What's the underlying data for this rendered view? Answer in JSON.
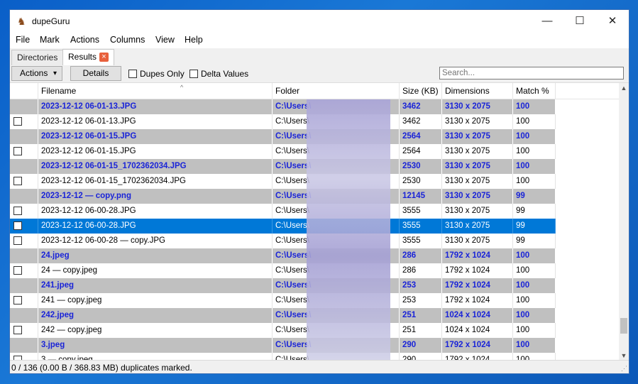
{
  "window": {
    "title": "dupeGuru",
    "minimize": "—",
    "maximize": "☐",
    "close": "✕"
  },
  "menu": [
    "File",
    "Mark",
    "Actions",
    "Columns",
    "View",
    "Help"
  ],
  "tabs": {
    "directories": "Directories",
    "results": "Results",
    "close_icon": "×"
  },
  "toolbar": {
    "actions_label": "Actions",
    "details_label": "Details",
    "dupes_only_label": "Dupes Only",
    "delta_values_label": "Delta Values",
    "search_placeholder": "Search...",
    "dropdown_icon": "▾"
  },
  "columns": [
    "Filename",
    "Folder",
    "Size (KB)",
    "Dimensions",
    "Match %"
  ],
  "sort_indicator": "^",
  "rows": [
    {
      "ref": true,
      "filename": "2023-12-12 06-01-13.JPG",
      "folder": "C:\\Users\\",
      "size": "3462",
      "dimensions": "3130 x 2075",
      "match": "100"
    },
    {
      "ref": false,
      "filename": "2023-12-12 06-01-13.JPG",
      "folder": "C:\\Users\\",
      "size": "3462",
      "dimensions": "3130 x 2075",
      "match": "100"
    },
    {
      "ref": true,
      "filename": "2023-12-12 06-01-15.JPG",
      "folder": "C:\\Users\\",
      "size": "2564",
      "dimensions": "3130 x 2075",
      "match": "100"
    },
    {
      "ref": false,
      "filename": "2023-12-12 06-01-15.JPG",
      "folder": "C:\\Users\\",
      "size": "2564",
      "dimensions": "3130 x 2075",
      "match": "100"
    },
    {
      "ref": true,
      "filename": "2023-12-12 06-01-15_1702362034.JPG",
      "folder": "C:\\Users\\",
      "size": "2530",
      "dimensions": "3130 x 2075",
      "match": "100"
    },
    {
      "ref": false,
      "filename": "2023-12-12 06-01-15_1702362034.JPG",
      "folder": "C:\\Users\\",
      "size": "2530",
      "dimensions": "3130 x 2075",
      "match": "100"
    },
    {
      "ref": true,
      "filename": "2023-12-12 — copy.png",
      "folder": "C:\\Users\\",
      "size": "12145",
      "dimensions": "3130 x 2075",
      "match": "99"
    },
    {
      "ref": false,
      "filename": "2023-12-12 06-00-28.JPG",
      "folder": "C:\\Users\\",
      "size": "3555",
      "dimensions": "3130 x 2075",
      "match": "99"
    },
    {
      "ref": false,
      "selected": true,
      "filename": "2023-12-12 06-00-28.JPG",
      "folder": "C:\\Users\\",
      "size": "3555",
      "dimensions": "3130 x 2075",
      "match": "99"
    },
    {
      "ref": false,
      "filename": "2023-12-12 06-00-28 — copy.JPG",
      "folder": "C:\\Users\\",
      "size": "3555",
      "dimensions": "3130 x 2075",
      "match": "99"
    },
    {
      "ref": true,
      "filename": "24.jpeg",
      "folder": "C:\\Users\\",
      "size": "286",
      "dimensions": "1792 x 1024",
      "match": "100"
    },
    {
      "ref": false,
      "filename": "24 — copy.jpeg",
      "folder": "C:\\Users\\",
      "size": "286",
      "dimensions": "1792 x 1024",
      "match": "100"
    },
    {
      "ref": true,
      "filename": "241.jpeg",
      "folder": "C:\\Users\\",
      "size": "253",
      "dimensions": "1792 x 1024",
      "match": "100"
    },
    {
      "ref": false,
      "filename": "241 — copy.jpeg",
      "folder": "C:\\Users\\",
      "size": "253",
      "dimensions": "1792 x 1024",
      "match": "100"
    },
    {
      "ref": true,
      "filename": "242.jpeg",
      "folder": "C:\\Users\\",
      "size": "251",
      "dimensions": "1024 x 1024",
      "match": "100"
    },
    {
      "ref": false,
      "filename": "242 — copy.jpeg",
      "folder": "C:\\Users\\",
      "size": "251",
      "dimensions": "1024 x 1024",
      "match": "100"
    },
    {
      "ref": true,
      "filename": "3.jpeg",
      "folder": "C:\\Users\\",
      "size": "290",
      "dimensions": "1792 x 1024",
      "match": "100"
    },
    {
      "ref": false,
      "filename": "3 — copy.jpeg",
      "folder": "C:\\Users\\",
      "size": "290",
      "dimensions": "1792 x 1024",
      "match": "100"
    }
  ],
  "status": "0 / 136 (0.00 B / 368.83 MB) duplicates marked.",
  "colors": {
    "ref_text": "#1a24d8",
    "ref_bg": "#c0c0c0",
    "selection": "#0078d7"
  }
}
